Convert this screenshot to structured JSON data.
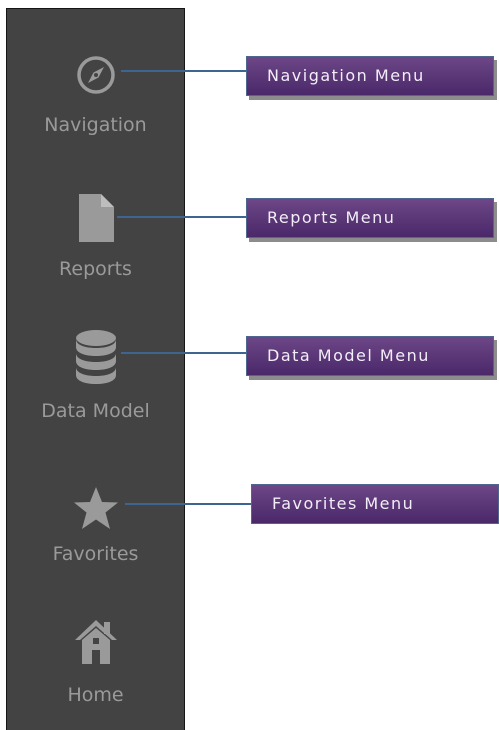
{
  "sidebar": {
    "items": [
      {
        "label": "Navigation",
        "icon": "compass-icon"
      },
      {
        "label": "Reports",
        "icon": "document-icon"
      },
      {
        "label": "Data Model",
        "icon": "database-icon"
      },
      {
        "label": "Favorites",
        "icon": "star-icon"
      },
      {
        "label": "Home",
        "icon": "home-icon"
      }
    ]
  },
  "callouts": [
    {
      "label": "Navigation Menu"
    },
    {
      "label": "Reports Menu"
    },
    {
      "label": "Data Model Menu"
    },
    {
      "label": "Favorites Menu"
    }
  ],
  "colors": {
    "sidebar_bg": "#434343",
    "icon_color": "#9a9a9a",
    "callout_top": "#6d4787",
    "callout_bottom": "#4a2869",
    "connector": "#3e6592"
  }
}
